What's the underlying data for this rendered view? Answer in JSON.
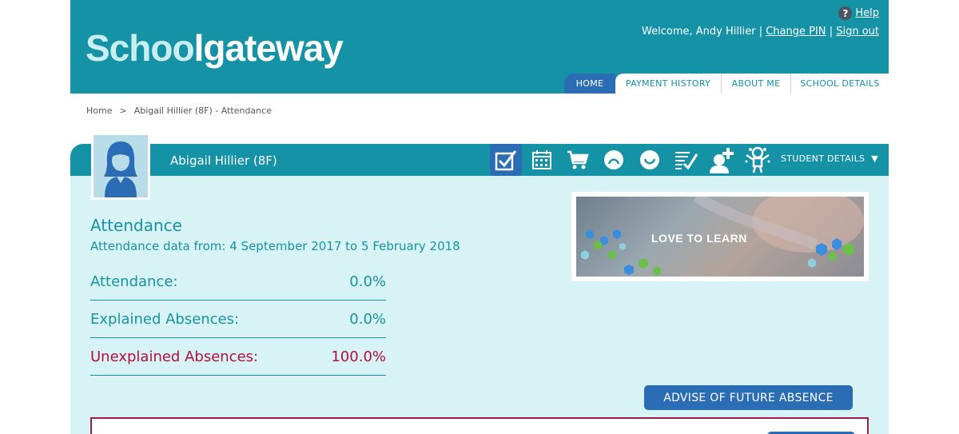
{
  "header": {
    "logo_part1": "Schoo",
    "logo_part2": "lgateway",
    "help_label": "Help",
    "welcome_text": "Welcome, Andy Hillier",
    "separator": "|",
    "change_pin_label": "Change PIN",
    "sign_out_label": "Sign out"
  },
  "nav": {
    "tabs": [
      "HOME",
      "PAYMENT HISTORY",
      "ABOUT ME",
      "SCHOOL DETAILS"
    ],
    "active_tab": "HOME"
  },
  "breadcrumb": {
    "home": "Home",
    "separator": ">",
    "current": "Abigail Hillier (8F) - Attendance"
  },
  "student": {
    "name": "Abigail Hillier (8F)",
    "details_label": "STUDENT DETAILS",
    "details_arrow": "▼",
    "icons": [
      "attendance-check-icon",
      "calendar-icon",
      "shopping-cart-icon",
      "sad-face-icon",
      "happy-face-icon",
      "checklist-icon",
      "person-add-icon",
      "child-icon"
    ]
  },
  "attendance": {
    "title": "Attendance",
    "date_range": "Attendance data from: 4 September 2017 to 5 February 2018",
    "stats": [
      {
        "label": "Attendance:",
        "value": "0.0%"
      },
      {
        "label": "Explained Absences:",
        "value": "0.0%"
      },
      {
        "label": "Unexplained Absences:",
        "value": "100.0%"
      }
    ]
  },
  "banner": {
    "text": "LOVE TO LEARN"
  },
  "actions": {
    "advise_label": "ADVISE OF FUTURE ABSENCE"
  },
  "colors": {
    "primary": "#1692a6",
    "accent_blue": "#2a6db4",
    "panel_bg": "#d8f3f5",
    "alert_red": "#b0103b"
  }
}
